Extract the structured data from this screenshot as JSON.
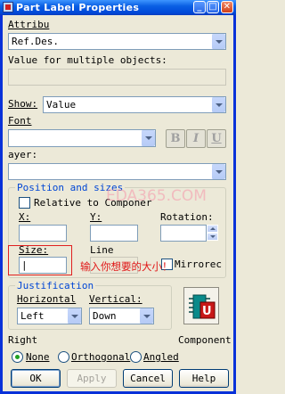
{
  "window": {
    "title": "Part Label Properties",
    "minimize": "_",
    "maximize": "□",
    "close": "✕"
  },
  "attribute": {
    "label": "Attribu",
    "value": "Ref.Des."
  },
  "multiple": {
    "label": "Value for multiple objects:"
  },
  "show": {
    "label": "Show:",
    "value": "Value"
  },
  "font": {
    "label": "Font",
    "bold": "B",
    "italic": "I",
    "underline": "U"
  },
  "layer": {
    "label": "ayer:"
  },
  "position": {
    "legend": "Position and sizes",
    "relative_label": "Relative to Componer",
    "x_label": "X:",
    "y_label": "Y:",
    "rotation_label": "Rotation:",
    "size_label": "Size:",
    "line_label": "Line",
    "mirrored_label": "Mirrorec",
    "size_value": "|"
  },
  "annotation": {
    "text": "输入你想要的大小！"
  },
  "watermark": "EDA365.COM",
  "justification": {
    "legend": "Justification",
    "horizontal_label": "Horizontal",
    "vertical_label": "Vertical:",
    "horizontal_value": "Left",
    "vertical_value": "Down"
  },
  "component": {
    "label": "Component"
  },
  "right": {
    "label": "Right",
    "options": [
      "None",
      "Orthogonal",
      "Angled"
    ],
    "selected": "None"
  },
  "buttons": {
    "ok": "OK",
    "apply": "Apply",
    "cancel": "Cancel",
    "help": "Help"
  },
  "colors": {
    "titlebar": "#0a5fe4",
    "legend": "#0046d5",
    "annotation": "#e01818",
    "face": "#ece9d8"
  }
}
